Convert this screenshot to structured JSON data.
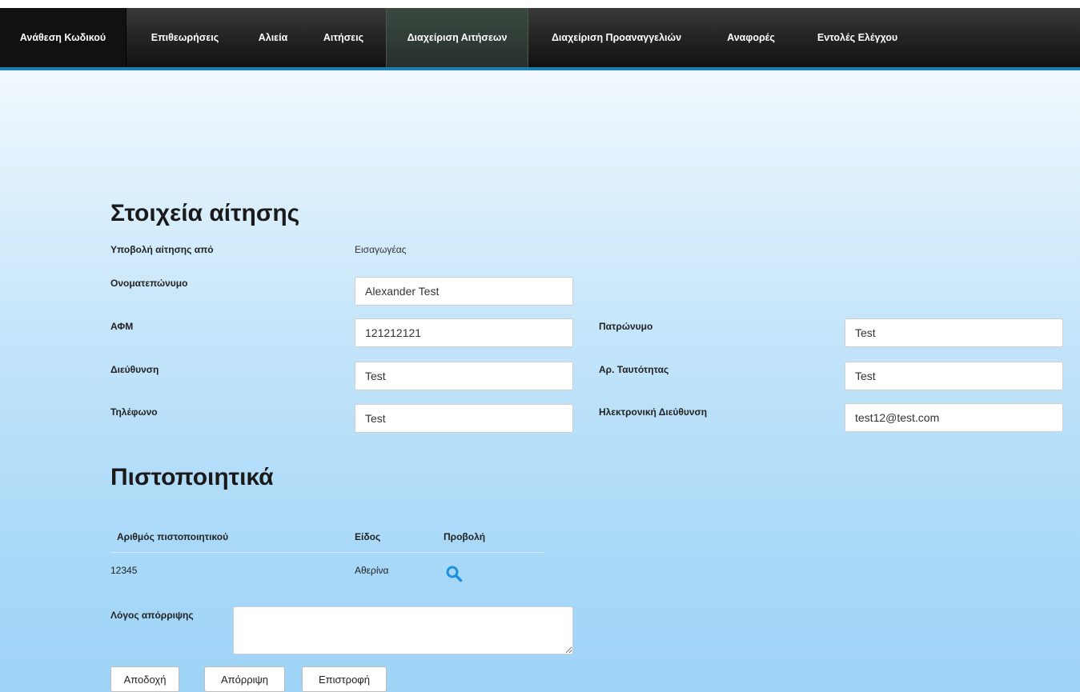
{
  "nav": {
    "items": [
      {
        "label": "Ανάθεση Κωδικού"
      },
      {
        "label": "Επιθεωρήσεις"
      },
      {
        "label": "Αλιεία"
      },
      {
        "label": "Αιτήσεις"
      },
      {
        "label": "Διαχείριση Αιτήσεων",
        "active": true
      },
      {
        "label": "Διαχείριση Προαναγγελιών"
      },
      {
        "label": "Αναφορές"
      },
      {
        "label": "Εντολές Ελέγχου"
      }
    ]
  },
  "application": {
    "title": "Στοιχεία αίτησης",
    "submitted_by_label": "Υποβολή αίτησης από",
    "submitted_by_value": "Εισαγωγέας",
    "fullname_label": "Ονοματεπώνυμο",
    "fullname_value": "Alexander Test",
    "afm_label": "ΑΦΜ",
    "afm_value": "121212121",
    "patronymic_label": "Πατρώνυμο",
    "patronymic_value": "Test",
    "address_label": "Διεύθυνση",
    "address_value": "Test",
    "id_number_label": "Αρ. Ταυτότητας",
    "id_number_value": "Test",
    "phone_label": "Τηλέφωνο",
    "phone_value": "Test",
    "email_label": "Ηλεκτρονική Διεύθυνση",
    "email_value": "test12@test.com"
  },
  "certificates": {
    "title": "Πιστοποιητικά",
    "headers": {
      "number": "Αριθμός πιστοποιητικού",
      "type": "Είδος",
      "view": "Προβολή"
    },
    "rows": [
      {
        "number": "12345",
        "type": "Αθερίνα",
        "view_icon": "search-icon"
      }
    ]
  },
  "rejection": {
    "label": "Λόγος απόρριψης",
    "value": ""
  },
  "buttons": {
    "accept": "Αποδοχή",
    "reject": "Απόρριψη",
    "back": "Επιστροφή"
  },
  "colors": {
    "nav_accent": "#1b7fb6",
    "icon": "#1e90e0"
  }
}
